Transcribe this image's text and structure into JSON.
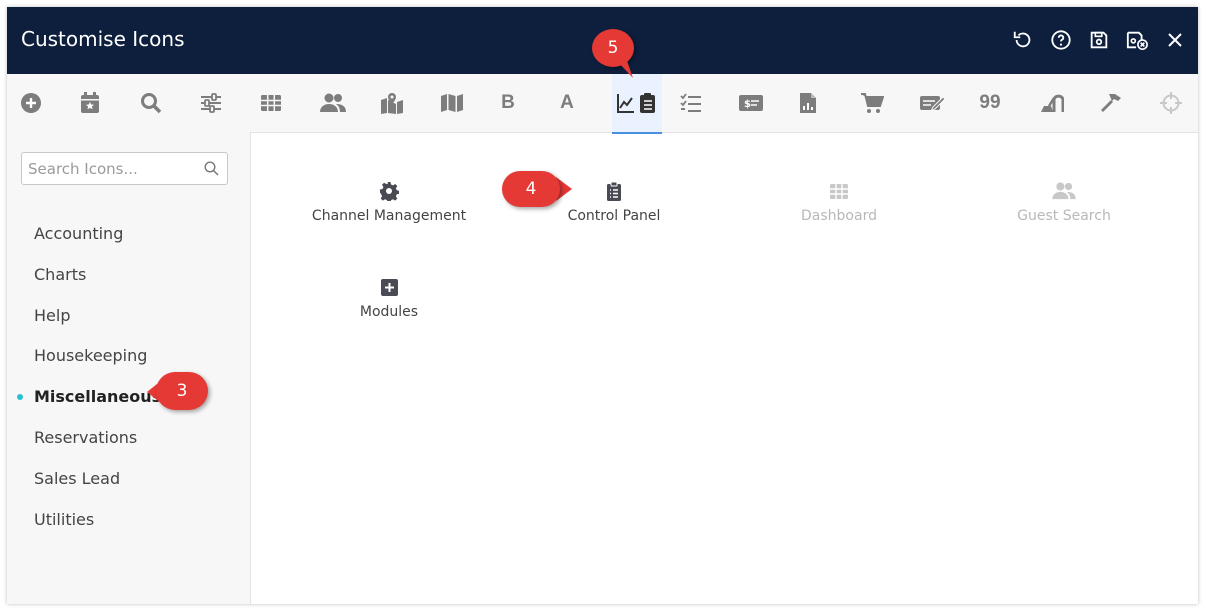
{
  "window": {
    "title": "Customise Icons"
  },
  "titlebar_icons": [
    "undo-icon",
    "help-icon",
    "save-icon",
    "save-close-icon",
    "close-icon"
  ],
  "toolbar": {
    "tools": [
      {
        "name": "add-icon"
      },
      {
        "name": "calendar-star-icon"
      },
      {
        "name": "search-icon"
      },
      {
        "name": "sliders-icon"
      },
      {
        "name": "table-icon"
      },
      {
        "name": "users-icon"
      },
      {
        "name": "map-marked-icon"
      },
      {
        "name": "map-icon"
      },
      {
        "name": "bold-icon",
        "label": "B"
      },
      {
        "name": "font-icon",
        "label": "A"
      },
      {
        "name": "chart-clipboard-icon",
        "active": true
      },
      {
        "name": "tasks-icon"
      },
      {
        "name": "money-bill-icon"
      },
      {
        "name": "file-chart-icon"
      },
      {
        "name": "cart-icon"
      },
      {
        "name": "sign-icon"
      },
      {
        "name": "quote-icon",
        "label": "99"
      },
      {
        "name": "vacuum-icon"
      },
      {
        "name": "hammer-icon"
      },
      {
        "name": "crosshair-icon"
      }
    ]
  },
  "sidebar": {
    "search_placeholder": "Search Icons...",
    "categories": [
      "Accounting",
      "Charts",
      "Help",
      "Housekeeping",
      "Miscellaneous",
      "Reservations",
      "Sales Lead",
      "Utilities"
    ],
    "active_category": "Miscellaneous"
  },
  "icons": [
    {
      "label": "Channel Management",
      "icon": "gear-icon",
      "enabled": true
    },
    {
      "label": "Control Panel",
      "icon": "clipboard-list-icon",
      "enabled": true
    },
    {
      "label": "Dashboard",
      "icon": "table-icon",
      "enabled": false
    },
    {
      "label": "Guest Search",
      "icon": "users-icon",
      "enabled": false
    },
    {
      "label": "Modules",
      "icon": "plus-square-icon",
      "enabled": true
    }
  ],
  "callouts": [
    "3",
    "4",
    "5"
  ],
  "colors": {
    "titlebar": "#0d1f3c",
    "callout": "#e53935",
    "active_dot": "#26c2d1"
  }
}
